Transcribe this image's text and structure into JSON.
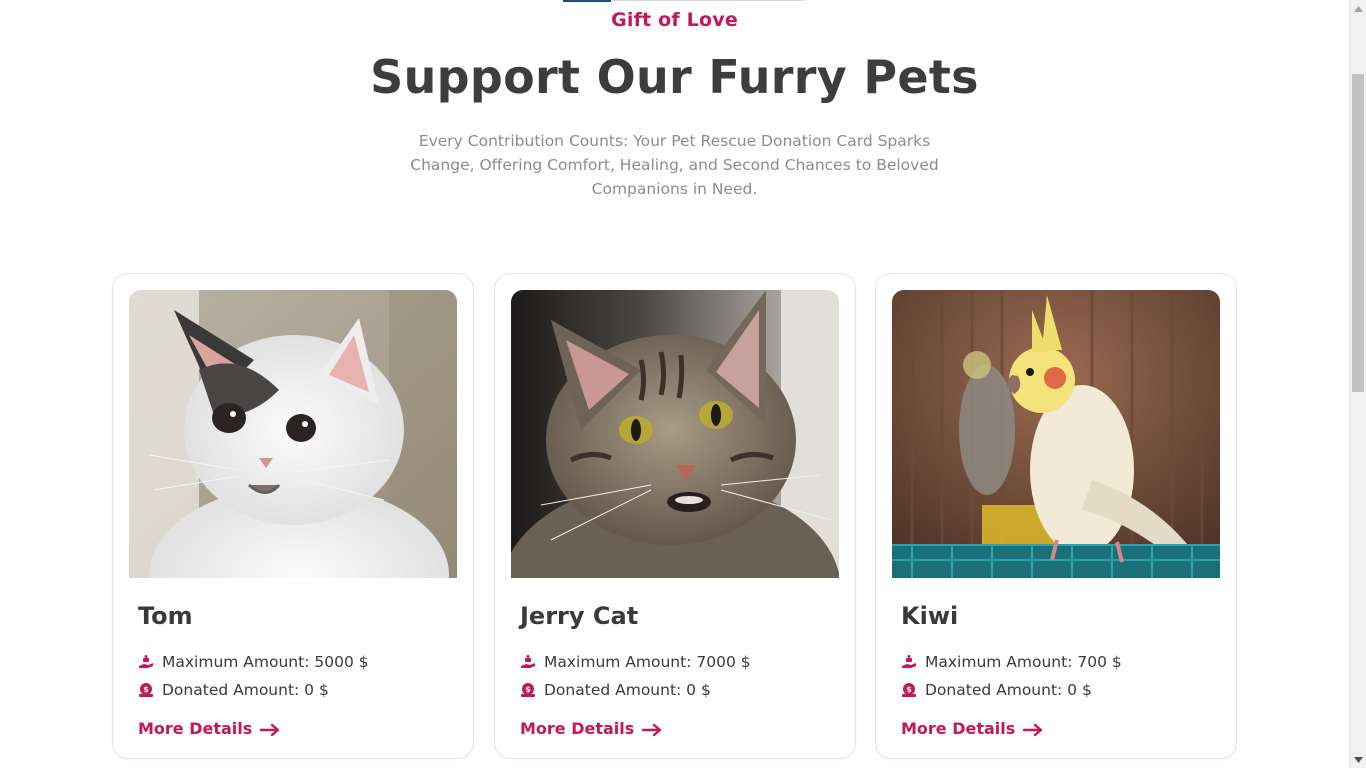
{
  "section": {
    "eyebrow": "Gift of Love",
    "title": "Support Our Furry Pets",
    "subtitle": "Every Contribution Counts: Your Pet Rescue Donation Card Sparks Change, Offering Comfort, Healing, and Second Chances to Beloved Companions in Need."
  },
  "colors": {
    "accent": "#c2185b",
    "heading": "#3d3d3d",
    "muted": "#8c8c8c"
  },
  "icons": {
    "max_amount": "hand-donate-icon",
    "donated_amount": "money-bag-icon",
    "details": "arrow-right-icon"
  },
  "cards": [
    {
      "name": "Tom",
      "image": "white-black-kitten-photo",
      "max_amount": "Maximum Amount: 5000 $",
      "donated_amount": "Donated Amount: 0 $",
      "link_label": "More Details"
    },
    {
      "name": "Jerry Cat",
      "image": "tabby-cat-photo",
      "max_amount": "Maximum Amount: 7000 $",
      "donated_amount": "Donated Amount: 0 $",
      "link_label": "More Details"
    },
    {
      "name": "Kiwi",
      "image": "cockatiel-bird-photo",
      "max_amount": "Maximum Amount: 700 $",
      "donated_amount": "Donated Amount: 0 $",
      "link_label": "More Details"
    }
  ]
}
